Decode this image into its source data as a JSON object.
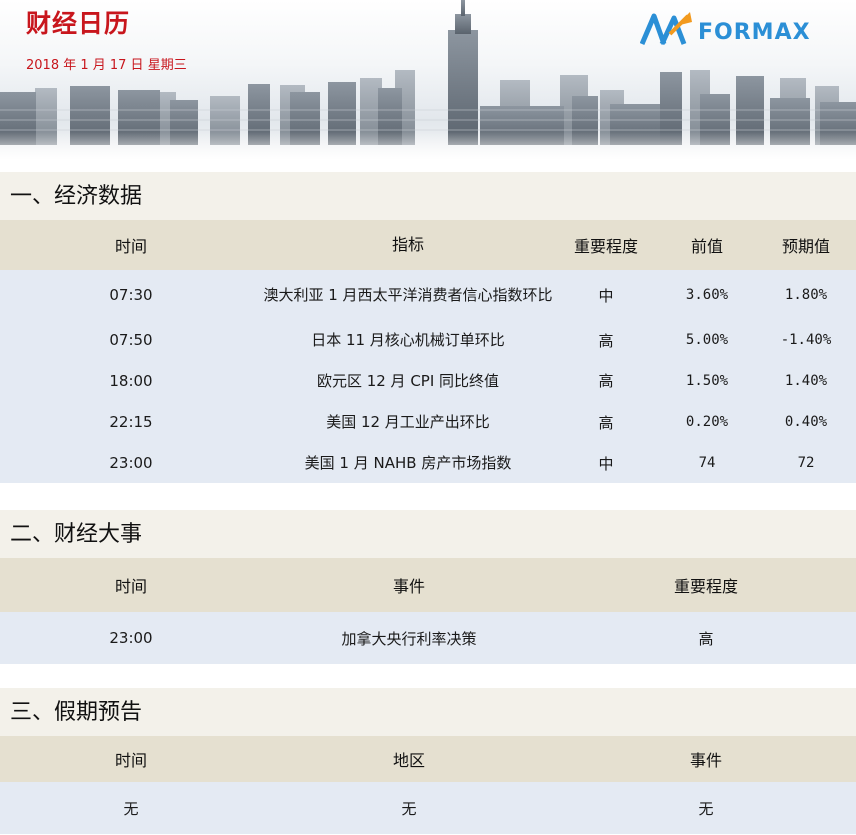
{
  "header": {
    "title": "财经日历",
    "date": "2018 年 1 月 17 日  星期三",
    "logo_text": "FORMAX",
    "brand_color": "#2b8fd6",
    "accent_color": "#c8161d"
  },
  "economic_data": {
    "heading": "一、经济数据",
    "columns": [
      "时间",
      "指标",
      "重要程度",
      "前值",
      "预期值"
    ],
    "rows": [
      {
        "time": "07:30",
        "indicator": "澳大利亚 1 月西太平洋消费者信心指数环比",
        "importance": "中",
        "previous": "3.60%",
        "forecast": "1.80%"
      },
      {
        "time": "07:50",
        "indicator": "日本 11 月核心机械订单环比",
        "importance": "高",
        "previous": "5.00%",
        "forecast": "-1.40%"
      },
      {
        "time": "18:00",
        "indicator": "欧元区 12 月 CPI 同比终值",
        "importance": "高",
        "previous": "1.50%",
        "forecast": "1.40%"
      },
      {
        "time": "22:15",
        "indicator": "美国 12 月工业产出环比",
        "importance": "高",
        "previous": "0.20%",
        "forecast": "0.40%"
      },
      {
        "time": "23:00",
        "indicator": "美国 1 月 NAHB 房产市场指数",
        "importance": "中",
        "previous": "74",
        "forecast": "72"
      }
    ]
  },
  "financial_events": {
    "heading": "二、财经大事",
    "columns": [
      "时间",
      "事件",
      "重要程度"
    ],
    "rows": [
      {
        "time": "23:00",
        "event": "加拿大央行利率决策",
        "importance": "高"
      }
    ]
  },
  "holidays": {
    "heading": "三、假期预告",
    "columns": [
      "时间",
      "地区",
      "事件"
    ],
    "rows": [
      {
        "time": "无",
        "region": "无",
        "event": "无"
      }
    ]
  }
}
